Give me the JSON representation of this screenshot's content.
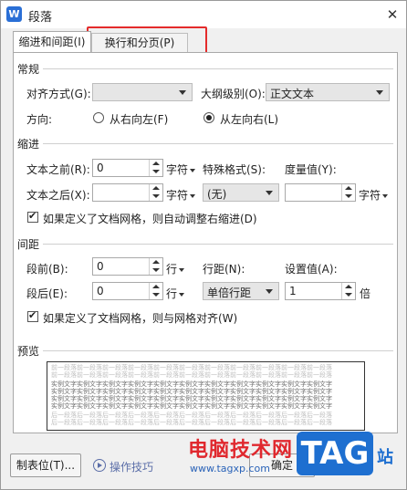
{
  "window": {
    "title": "段落",
    "app_icon_letter": "W"
  },
  "tabs": [
    {
      "label": "缩进和间距(I)",
      "active": true
    },
    {
      "label": "换行和分页(P)",
      "active": false
    }
  ],
  "general": {
    "section": "常规",
    "alignment_label": "对齐方式(G):",
    "alignment_value": "",
    "outline_label": "大纲级别(O):",
    "outline_value": "正文文本",
    "direction_label": "方向:",
    "rtl_label": "从右向左(F)",
    "ltr_label": "从左向右(L)",
    "selected_direction": "ltr"
  },
  "indent": {
    "section": "缩进",
    "before_label": "文本之前(R):",
    "before_value": "0",
    "before_unit": "字符",
    "after_label": "文本之后(X):",
    "after_value": "",
    "after_unit": "字符",
    "special_label": "特殊格式(S):",
    "special_value": "(无)",
    "measure_label": "度量值(Y):",
    "measure_value": "",
    "measure_unit": "字符",
    "auto_adjust_label": "如果定义了文档网格，则自动调整右缩进(D)",
    "auto_adjust_checked": true
  },
  "spacing": {
    "section": "间距",
    "before_label": "段前(B):",
    "before_value": "0",
    "before_unit": "行",
    "after_label": "段后(E):",
    "after_value": "0",
    "after_unit": "行",
    "line_label": "行距(N):",
    "line_value": "单倍行距",
    "setting_label": "设置值(A):",
    "setting_value": "1",
    "setting_unit": "倍",
    "snap_grid_label": "如果定义了文档网格，则与网格对齐(W)",
    "snap_grid_checked": true
  },
  "preview": {
    "section": "预览",
    "prev_text": "前一段落前一段落前一段落前一段落前一段落前一段落前一段落前一段落前一段落前一段落前一段落",
    "sample_text": "实例文字实例文字实例文字实例文字实例文字实例文字实例文字实例文字实例文字实例文字实例文字",
    "next_text": "后一段落后一段落后一段落后一段落后一段落后一段落后一段落后一段落后一段落后一段落后一段落"
  },
  "footer": {
    "tabs_button": "制表位(T)...",
    "tips_label": "操作技巧",
    "ok_button": "确定"
  },
  "watermark": {
    "site_name": "电脑技术网",
    "url": "www.tagxp.com",
    "badge": "TAG",
    "suffix": "站"
  },
  "colors": {
    "highlight": "#e42b2b",
    "app_icon": "#2a6fd6",
    "watermark_red": "#e0282e",
    "watermark_blue": "#1e6fd0"
  }
}
